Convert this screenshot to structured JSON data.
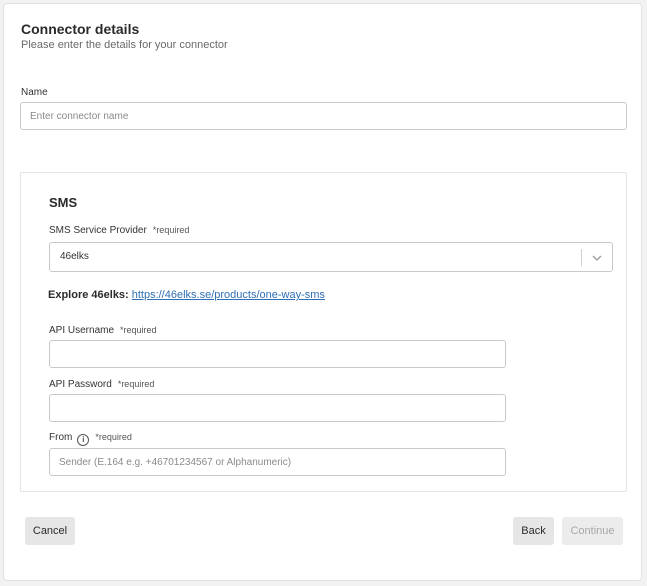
{
  "header": {
    "title": "Connector details",
    "subtitle": "Please enter the details for your connector"
  },
  "name_field": {
    "label": "Name",
    "placeholder": "Enter connector name",
    "value": ""
  },
  "sms": {
    "title": "SMS",
    "provider": {
      "label": "SMS Service Provider",
      "required": "*required",
      "selected": "46elks"
    },
    "explore": {
      "label": "Explore 46elks:",
      "link": "https://46elks.se/products/one-way-sms"
    },
    "api_username": {
      "label": "API Username",
      "required": "*required",
      "value": ""
    },
    "api_password": {
      "label": "API Password",
      "required": "*required",
      "value": ""
    },
    "from": {
      "label": "From",
      "info_icon": "info-icon",
      "info_glyph": "i",
      "required": "*required",
      "placeholder": "Sender (E.164 e.g. +46701234567 or Alphanumeric)",
      "value": ""
    }
  },
  "footer": {
    "cancel_label": "Cancel",
    "back_label": "Back",
    "continue_label": "Continue"
  },
  "colors": {
    "link": "#2f6fb5",
    "border": "#c9c9c9",
    "button_bg": "#e6e6e6",
    "disabled_text": "#a7a7a7"
  }
}
